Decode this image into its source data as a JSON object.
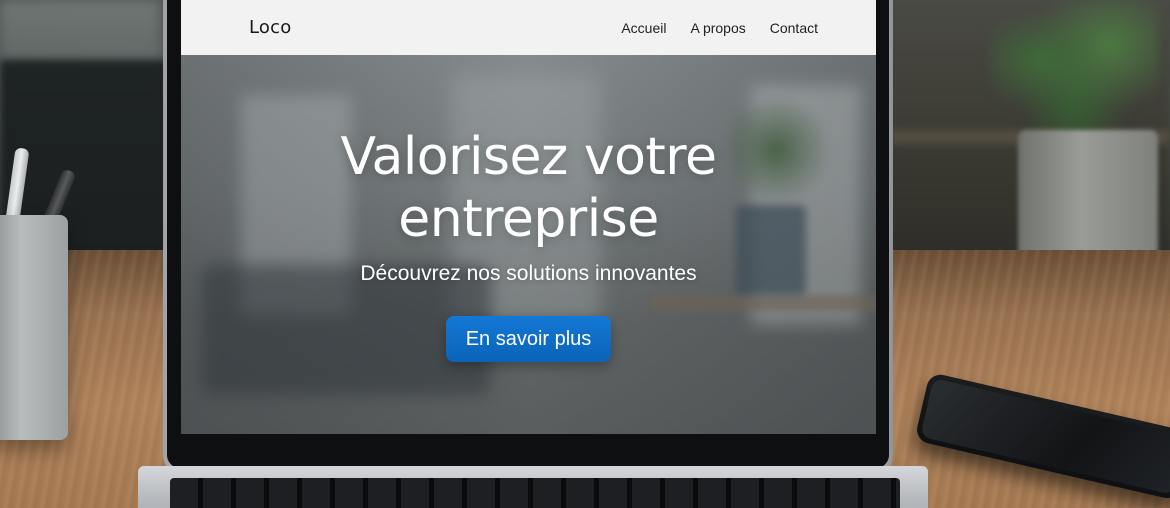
{
  "site": {
    "logo": "Loco",
    "nav": [
      {
        "label": "Accueil"
      },
      {
        "label": "A propos"
      },
      {
        "label": "Contact"
      }
    ],
    "hero": {
      "title": "Valorisez votre entreprise",
      "subtitle": "Découvrez nos solutions innovantes",
      "cta_label": "En savoir plus"
    }
  },
  "colors": {
    "cta_background": "#0a6fca",
    "nav_background": "#f2f2f2",
    "hero_text": "#ffffff"
  }
}
